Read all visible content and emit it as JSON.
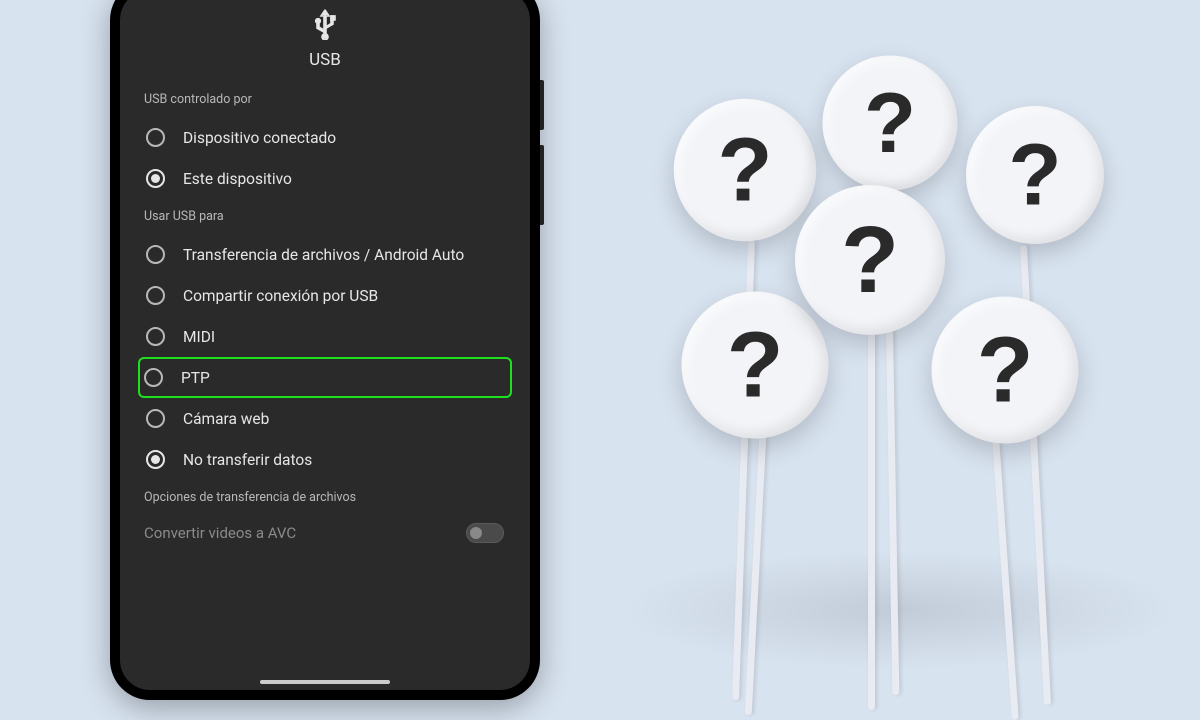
{
  "header": {
    "title": "USB",
    "icon": "usb-icon"
  },
  "sections": {
    "controlled_by": {
      "label": "USB controlado por",
      "options": [
        {
          "label": "Dispositivo conectado",
          "selected": false
        },
        {
          "label": "Este dispositivo",
          "selected": true
        }
      ]
    },
    "use_for": {
      "label": "Usar USB para",
      "options": [
        {
          "label": "Transferencia de archivos / Android Auto",
          "selected": false,
          "highlighted": false
        },
        {
          "label": "Compartir conexión por USB",
          "selected": false,
          "highlighted": false
        },
        {
          "label": "MIDI",
          "selected": false,
          "highlighted": false
        },
        {
          "label": "PTP",
          "selected": false,
          "highlighted": true
        },
        {
          "label": "Cámara web",
          "selected": false,
          "highlighted": false
        },
        {
          "label": "No transferir datos",
          "selected": true,
          "highlighted": false
        }
      ]
    },
    "file_options": {
      "label": "Opciones de transferencia de archivos",
      "toggle": {
        "label": "Convertir videos a AVC",
        "on": false
      }
    }
  },
  "illustration": {
    "type": "question-mark-signs",
    "count": 6
  },
  "colors": {
    "page_bg": "#d8e3f0",
    "phone_bg": "#2a2a2a",
    "text": "#e6e6e6",
    "muted": "#b8b8b8",
    "highlight_border": "#1ee01e"
  }
}
